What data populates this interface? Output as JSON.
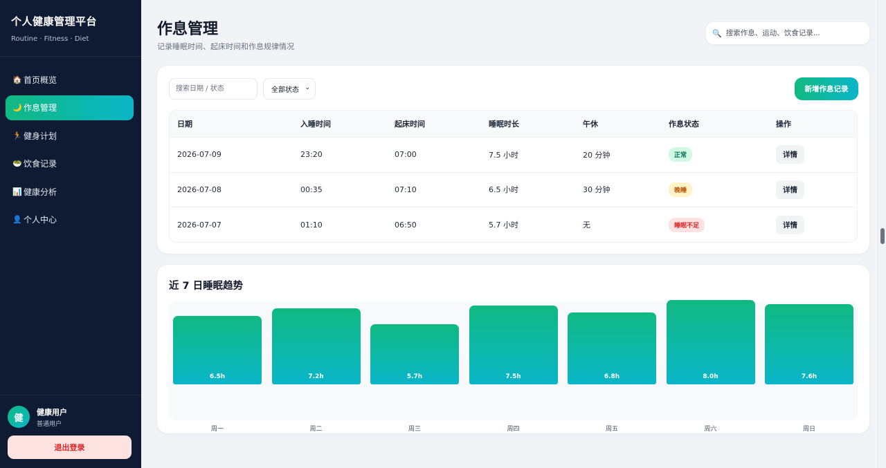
{
  "sidebar": {
    "brand_title": "个人健康管理平台",
    "brand_subtitle": "Routine · Fitness · Diet",
    "items": [
      {
        "icon": "🏠",
        "icon_name": "home-icon",
        "label": "首页概览"
      },
      {
        "icon": "🌙",
        "icon_name": "moon-icon",
        "label": "作息管理"
      },
      {
        "icon": "🏃",
        "icon_name": "running-icon",
        "label": "健身计划"
      },
      {
        "icon": "🥗",
        "icon_name": "salad-icon",
        "label": "饮食记录"
      },
      {
        "icon": "📊",
        "icon_name": "chart-icon",
        "label": "健康分析"
      },
      {
        "icon": "👤",
        "icon_name": "user-icon",
        "label": "个人中心"
      }
    ],
    "active_index": 1,
    "user": {
      "avatar_text": "健",
      "name": "健康用户",
      "role": "普通用户"
    },
    "logout_label": "退出登录"
  },
  "header": {
    "title": "作息管理",
    "subtitle": "记录睡眠时间、起床时间和作息规律情况",
    "search_placeholder": "搜索作息、运动、饮食记录..."
  },
  "filters": {
    "search_placeholder": "搜索日期 / 状态",
    "status_select": "全部状态",
    "add_button": "新增作息记录"
  },
  "table": {
    "headers": [
      "日期",
      "入睡时间",
      "起床时间",
      "睡眠时长",
      "午休",
      "作息状态",
      "操作"
    ],
    "rows": [
      {
        "date": "2026-07-09",
        "sleep": "23:20",
        "wake": "07:00",
        "duration": "7.5 小时",
        "nap": "20 分钟",
        "status": "正常",
        "status_type": "ok",
        "action": "详情"
      },
      {
        "date": "2026-07-08",
        "sleep": "00:35",
        "wake": "07:10",
        "duration": "6.5 小时",
        "nap": "30 分钟",
        "status": "晚睡",
        "status_type": "late",
        "action": "详情"
      },
      {
        "date": "2026-07-07",
        "sleep": "01:10",
        "wake": "06:50",
        "duration": "5.7 小时",
        "nap": "无",
        "status": "睡眠不足",
        "status_type": "bad",
        "action": "详情"
      }
    ]
  },
  "chart_data": {
    "type": "bar",
    "title": "近 7 日睡眠趋势",
    "categories": [
      "周一",
      "周二",
      "周三",
      "周四",
      "周五",
      "周六",
      "周日"
    ],
    "values": [
      6.5,
      7.2,
      5.7,
      7.5,
      6.8,
      8.0,
      7.6
    ],
    "value_labels": [
      "6.5h",
      "7.2h",
      "5.7h",
      "7.5h",
      "6.8h",
      "8.0h",
      "7.6h"
    ],
    "unit": "h",
    "colors": [
      "#10b981",
      "#0ab6c9"
    ]
  },
  "colors": {
    "sidebar_bg": "#0f1b33",
    "accent_start": "#10b981",
    "accent_end": "#0ab6c9",
    "danger": "#dc2626"
  }
}
